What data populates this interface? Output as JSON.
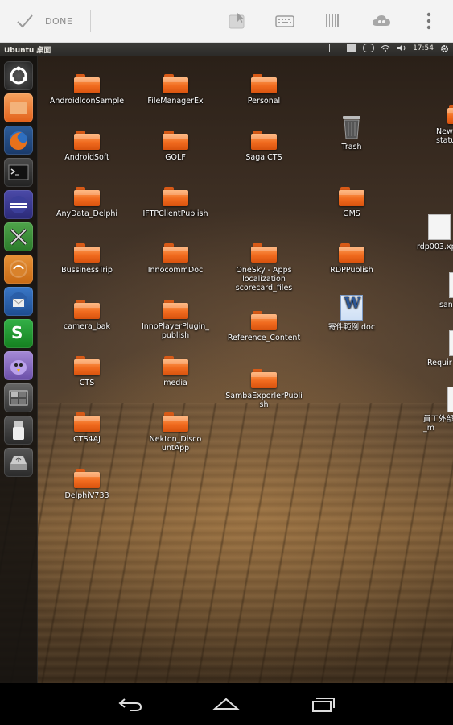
{
  "actionbar": {
    "done_label": "DONE",
    "icons": [
      "check-icon",
      "mouse-icon",
      "keyboard-icon",
      "barcode-icon",
      "cloud-icon",
      "overflow-menu-icon"
    ]
  },
  "panel": {
    "title": "Ubuntu 桌面",
    "time": "17:54"
  },
  "launcher": {
    "items": [
      "ubuntu-dash",
      "files",
      "firefox",
      "terminal",
      "eclipse",
      "system-settings",
      "sublime",
      "thunderbird",
      "skype",
      "pidgin",
      "workspace-switcher",
      "usb-drive",
      "removable-drive"
    ]
  },
  "desktop": {
    "icons": [
      {
        "label": "AndroidIconSample",
        "type": "folder"
      },
      {
        "label": "FileManagerEx",
        "type": "folder"
      },
      {
        "label": "Personal",
        "type": "folder"
      },
      {
        "label": "AndroidSoft",
        "type": "folder"
      },
      {
        "label": "GOLF",
        "type": "folder"
      },
      {
        "label": "Saga CTS",
        "type": "folder"
      },
      {
        "label": "Trash",
        "type": "trash"
      },
      {
        "label": "New\nstatus",
        "type": "folder"
      },
      {
        "label": "AnyData_Delphi",
        "type": "folder"
      },
      {
        "label": "IFTPClientPublish",
        "type": "folder"
      },
      {
        "label": "GMS",
        "type": "folder"
      },
      {
        "label": "rdp003.xp",
        "type": "file"
      },
      {
        "label": "BussinessTrip",
        "type": "folder"
      },
      {
        "label": "InnocommDoc",
        "type": "folder"
      },
      {
        "label": "OneSky - Apps localization scorecard_files",
        "type": "folder"
      },
      {
        "label": "RDPPublish",
        "type": "folder"
      },
      {
        "label": "san",
        "type": "file"
      },
      {
        "label": "camera_bak",
        "type": "folder"
      },
      {
        "label": "InnoPlayerPlugin_publish",
        "type": "folder"
      },
      {
        "label": "Reference_Content",
        "type": "folder"
      },
      {
        "label": "寄件範例.doc",
        "type": "doc"
      },
      {
        "label": "Requir",
        "type": "file"
      },
      {
        "label": "CTS",
        "type": "folder"
      },
      {
        "label": "media",
        "type": "folder"
      },
      {
        "label": "SambaExporlerPublish",
        "type": "folder"
      },
      {
        "label": "員工外部\n_m",
        "type": "file"
      },
      {
        "label": "CTS4AJ",
        "type": "folder"
      },
      {
        "label": "Nekton_DiscountApp",
        "type": "folder"
      },
      {
        "label": "DelphiV733",
        "type": "folder"
      }
    ]
  },
  "navbar": {
    "buttons": [
      "back-icon",
      "home-icon",
      "recent-apps-icon"
    ]
  }
}
